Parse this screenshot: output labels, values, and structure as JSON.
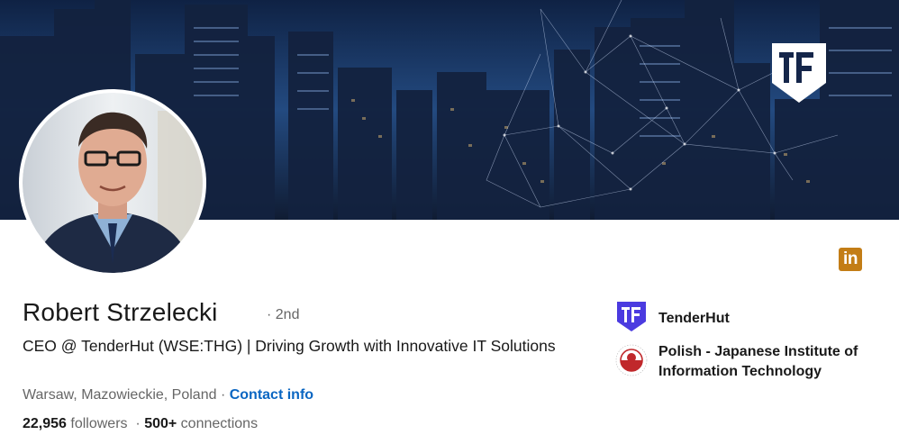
{
  "profile": {
    "name": "Robert Strzelecki",
    "degree": "· 2nd",
    "headline": "CEO @ TenderHut (WSE:THG) | Driving Growth with Innovative IT Solutions",
    "location": "Warsaw, Mazowieckie, Poland",
    "separator": " · ",
    "contact_label": "Contact info",
    "followers_count": "22,956",
    "followers_label": " followers",
    "connections_sep": "  · ",
    "connections_count": "500+",
    "connections_label": " connections"
  },
  "banner": {
    "logo_icon": "tenderhut-shield-logo"
  },
  "badge_icon": "linkedin-icon",
  "badge_text": "in",
  "orgs": [
    {
      "name": "TenderHut",
      "icon": "tenderhut-logo-icon"
    },
    {
      "name": "Polish - Japanese Institute of Information Technology",
      "icon": "pjatk-seal-icon"
    }
  ],
  "colors": {
    "link": "#0a66c2",
    "linkedin_badge": "#c37d16",
    "tenderhut_brand": "#4b3be0"
  }
}
